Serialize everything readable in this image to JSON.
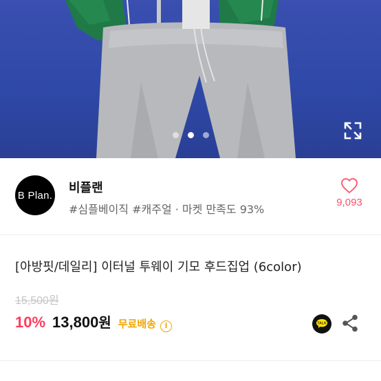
{
  "gallery": {
    "dot_count": 3,
    "active_index": 1
  },
  "shop": {
    "logo_text": "B Plan.",
    "name": "비플랜",
    "tags": "#심플베이직 #캐주얼 · 마켓 만족도 93%",
    "likes": "9,093"
  },
  "product": {
    "title": "[아방핏/데일리] 이터널 투웨이 기모 후드집업 (6color)",
    "original_price": "15,500원",
    "discount": "10%",
    "price": "13,800",
    "price_unit": "원",
    "shipping": "무료배송",
    "talk_label": "TALK"
  },
  "colors": {
    "accent_pink": "#ff4f6a",
    "discount_red": "#ff3b5c",
    "shipping_orange": "#f0a500",
    "talk_yellow": "#fee500"
  }
}
